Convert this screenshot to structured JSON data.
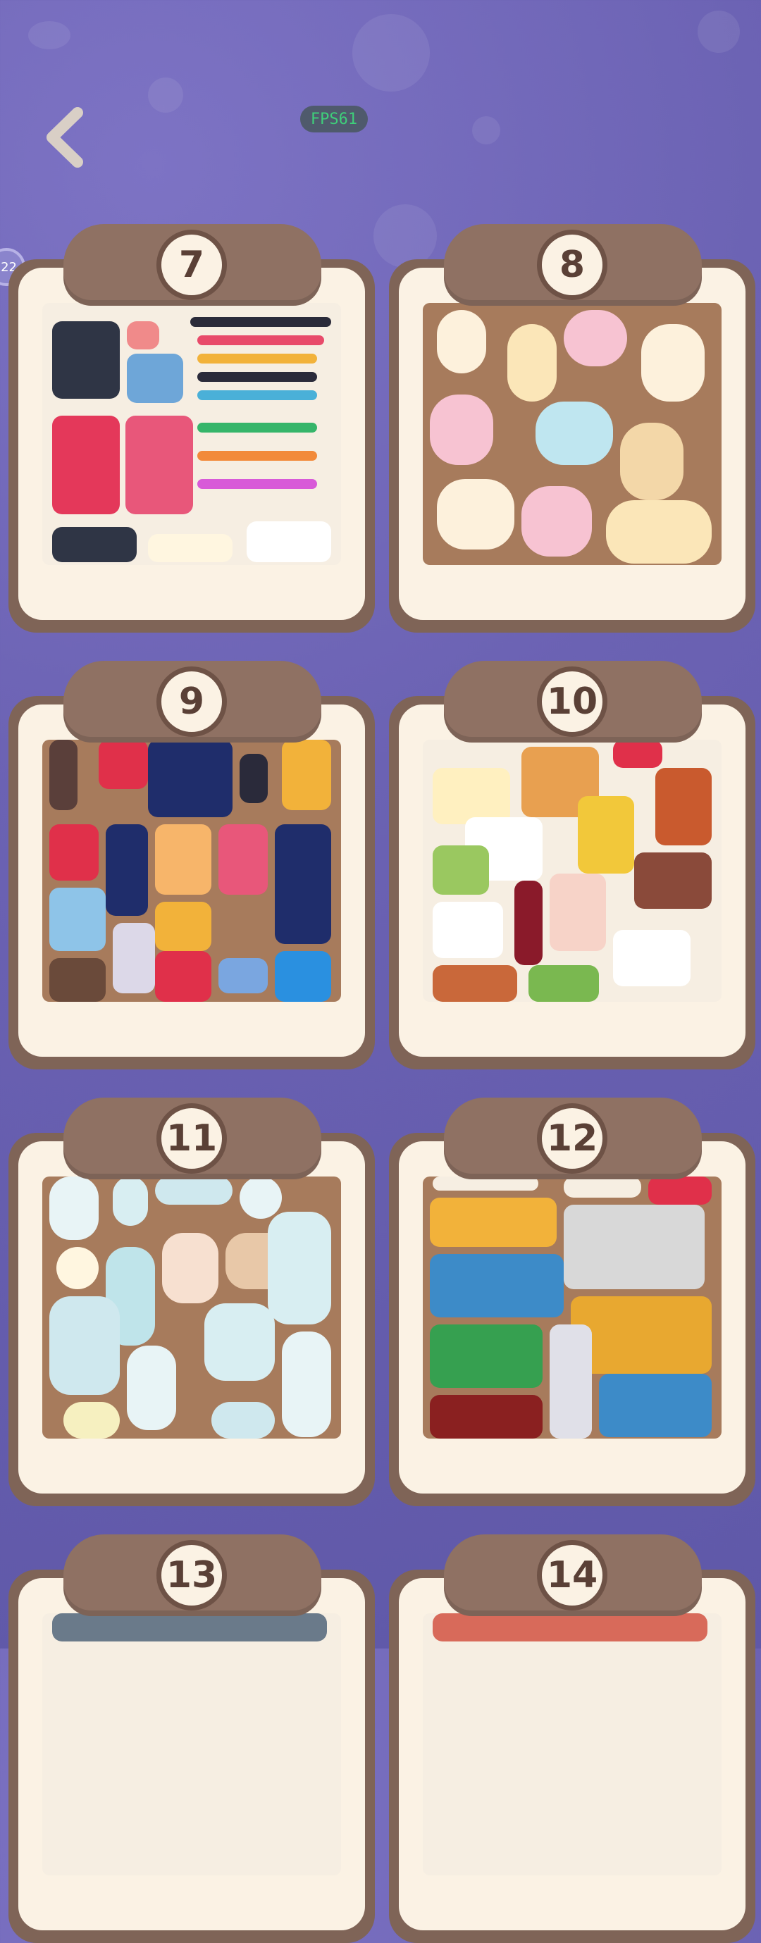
{
  "header": {
    "back_icon": "chevron-left-icon",
    "fps_text": "FPS61",
    "side_badge": "22"
  },
  "levels": [
    {
      "number": "7",
      "theme_bg": "#f6eee2",
      "accent": "#e4385a"
    },
    {
      "number": "8",
      "theme_bg": "#a77b5c",
      "accent": "#f7c3d2"
    },
    {
      "number": "9",
      "theme_bg": "#a77b5c",
      "accent": "#1f2d6b"
    },
    {
      "number": "10",
      "theme_bg": "#f6eee2",
      "accent": "#c95a2e"
    },
    {
      "number": "11",
      "theme_bg": "#a77b5c",
      "accent": "#bfe4ea"
    },
    {
      "number": "12",
      "theme_bg": "#a77b5c",
      "accent": "#3d8bc8"
    },
    {
      "number": "13",
      "theme_bg": "#f6eee2",
      "accent": "#6a7a8a"
    },
    {
      "number": "14",
      "theme_bg": "#f6eee2",
      "accent": "#d86a5a"
    }
  ],
  "colors": {
    "background": "#6b62b3",
    "card_frame": "#8f7163",
    "card_face": "#fbf2e4",
    "fps_text": "#3fcf7a"
  }
}
